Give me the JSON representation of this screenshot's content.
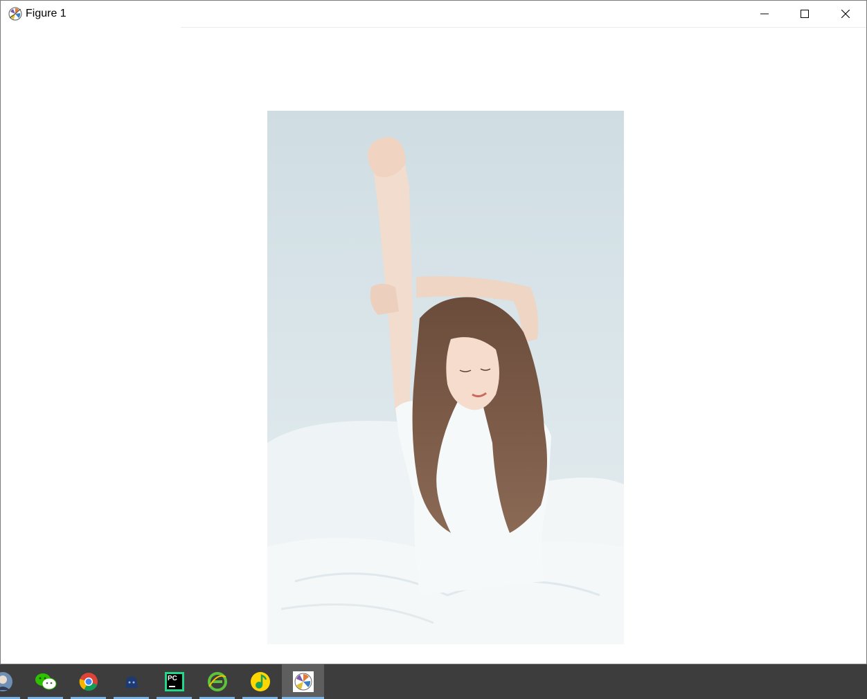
{
  "window": {
    "title": "Figure 1",
    "controls": {
      "minimize": "minimize",
      "maximize": "maximize",
      "close": "close"
    }
  },
  "figure": {
    "image_description_icon": "photo"
  },
  "taskbar": {
    "items": [
      {
        "name": "user-avatar-icon"
      },
      {
        "name": "wechat-icon"
      },
      {
        "name": "chrome-icon"
      },
      {
        "name": "blue-app-icon"
      },
      {
        "name": "pycharm-icon",
        "label": "PC"
      },
      {
        "name": "ie-browser-icon"
      },
      {
        "name": "qq-music-icon"
      },
      {
        "name": "matplotlib-figure-icon"
      }
    ]
  },
  "colors": {
    "taskbar_bg": "#3d3d3d",
    "taskbar_active": "#5e5e5e",
    "taskbar_indicator": "#77b3e6"
  }
}
